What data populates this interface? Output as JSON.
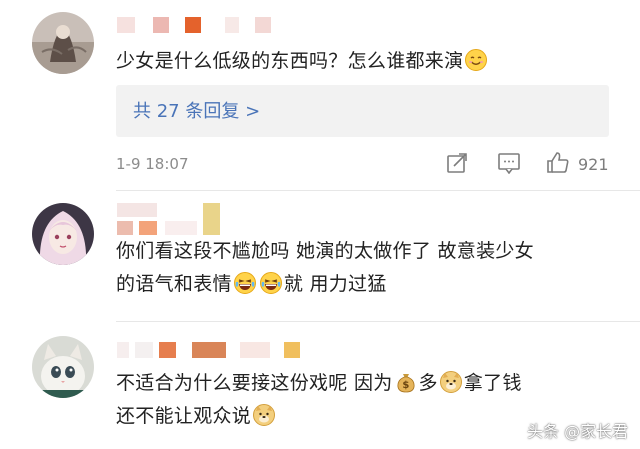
{
  "comments": [
    {
      "text": "少女是什么低级的东西吗？怎么谁都来演",
      "reply_link": "共 27 条回复 >",
      "date": "1-9 18:07",
      "likes": "921"
    },
    {
      "line1": "你们看这段不尴尬吗 她演的太做作了 故意装少女",
      "line2a": "的语气和表情",
      "line2b": "就 用力过猛"
    },
    {
      "line1a": "不适合为什么要接这份戏呢 因为",
      "line1b": "多",
      "line1c": "拿了钱",
      "line2": "还不能让观众说"
    }
  ],
  "icons": {
    "share": "share-icon",
    "comment": "comment-icon",
    "like": "thumbs-up-icon",
    "emoji_smile": "smile-emoji",
    "emoji_laugh": "laugh-cry-emoji",
    "emoji_money": "money-bag-emoji",
    "emoji_doge": "doge-emoji"
  },
  "watermark": "头条 @家长君",
  "colors": {
    "link": "#4a74b8",
    "meta": "#8c8c8c",
    "reply_bg": "#f2f2f2"
  }
}
